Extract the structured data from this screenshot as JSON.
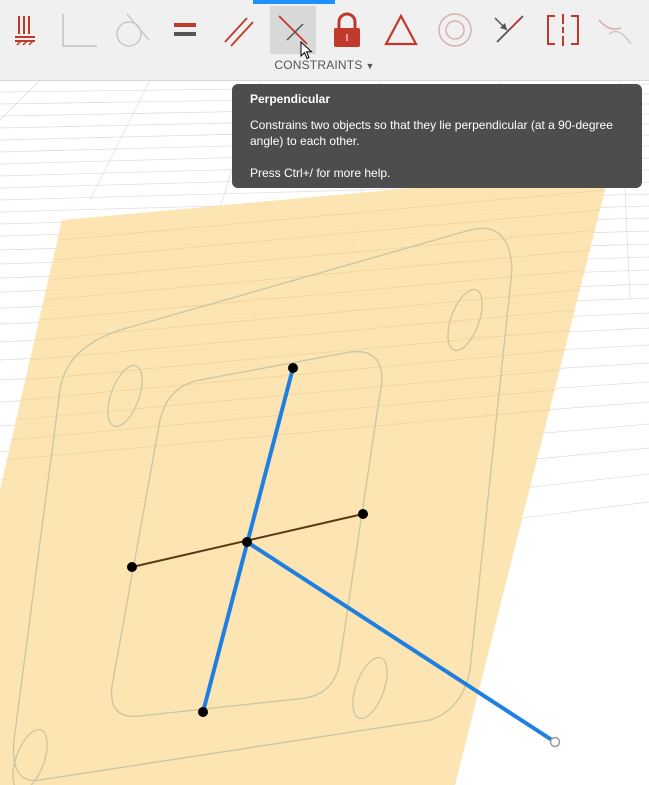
{
  "toolbar": {
    "group_label": "CONSTRAINTS",
    "tools": [
      {
        "name": "fix-unfix-icon",
        "color": "#c0392b"
      },
      {
        "name": "coincident-icon",
        "color": "#c0c0c0"
      },
      {
        "name": "tangent-icon",
        "color": "#c0c0c0"
      },
      {
        "name": "equal-icon",
        "color": "#c0392b"
      },
      {
        "name": "parallel-icon",
        "color": "#c0392b"
      },
      {
        "name": "perpendicular-icon",
        "color": "#c0392b",
        "active": true
      },
      {
        "name": "horizontal-vertical-lock-icon",
        "color": "#c0392b"
      },
      {
        "name": "midpoint-triangle-icon",
        "color": "#c0392b"
      },
      {
        "name": "concentric-icon",
        "color": "#c0c0c0"
      },
      {
        "name": "collinear-icon",
        "color": "#c0392b"
      },
      {
        "name": "symmetry-icon",
        "color": "#c0392b"
      },
      {
        "name": "curvature-icon",
        "color": "#c0c0c0"
      }
    ]
  },
  "tooltip": {
    "title": "Perpendicular",
    "description": "Constrains two objects so that they lie perpendicular (at a 90-degree angle) to each other.",
    "help": "Press Ctrl+/ for more help."
  },
  "colors": {
    "accent": "#1e90ff",
    "sketch_plane": "#fbdfa6",
    "selected_line": "#1f7fe0",
    "construction_line": "#5a3a14"
  }
}
